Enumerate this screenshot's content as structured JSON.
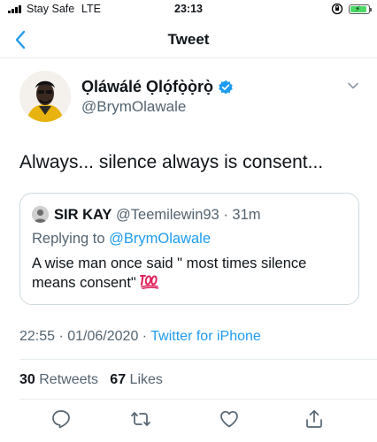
{
  "status_bar": {
    "carrier": "Stay Safe",
    "network": "LTE",
    "time": "23:13",
    "battery_level": 0.9,
    "battery_color": "#4cd964"
  },
  "header": {
    "title": "Tweet",
    "back_icon": "chevron-left-icon"
  },
  "tweet": {
    "author_name": "Ọláwálé Ọlọ́fọ̀ọ̀rọ̀",
    "author_handle": "@BrymOlawale",
    "verified": true,
    "text": "Always... silence always is consent...",
    "timestamp": "22:55 · 01/06/2020",
    "separator": "·",
    "source": "Twitter for iPhone",
    "retweet_count": "30",
    "retweet_label": "Retweets",
    "like_count": "67",
    "like_label": "Likes"
  },
  "quote": {
    "name": "SIR KAY",
    "handle": "@Teemilewin93",
    "time": "31m",
    "replying_prefix": "Replying to",
    "replying_to": "@BrymOlawale",
    "text": "A wise man once said \" most times silence means consent\"",
    "emoji": "100-emoji"
  },
  "actions": [
    {
      "icon": "reply-icon"
    },
    {
      "icon": "retweet-icon"
    },
    {
      "icon": "like-icon"
    },
    {
      "icon": "share-icon"
    }
  ],
  "colors": {
    "accent": "#1d9bf0",
    "text": "#0f1419",
    "secondary": "#536471",
    "border": "#cfd9de"
  }
}
